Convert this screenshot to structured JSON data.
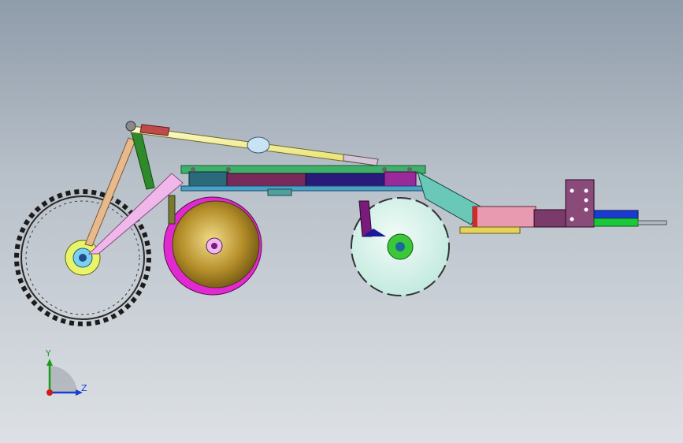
{
  "window": {
    "background_top": "#8f9caa",
    "background_bottom": "#dde1e5"
  },
  "model": {
    "view": "side",
    "components": [
      {
        "name": "packer-wheel",
        "color": "#2a2a2a"
      },
      {
        "name": "coulter-disc",
        "color": "#c8a43a"
      },
      {
        "name": "closing-wheel",
        "color": "#d6f2ea"
      },
      {
        "name": "hydraulic-cylinder",
        "color": "#f6f29a"
      },
      {
        "name": "frame-beam",
        "color": "#3b2a8c"
      },
      {
        "name": "mount-bracket",
        "color": "#7b4a6a"
      }
    ]
  },
  "triad": {
    "y_label": "Y",
    "z_label": "Z",
    "y_color": "#1a9c1a",
    "z_color": "#1a3fd0",
    "origin_color": "#d01a1a"
  }
}
